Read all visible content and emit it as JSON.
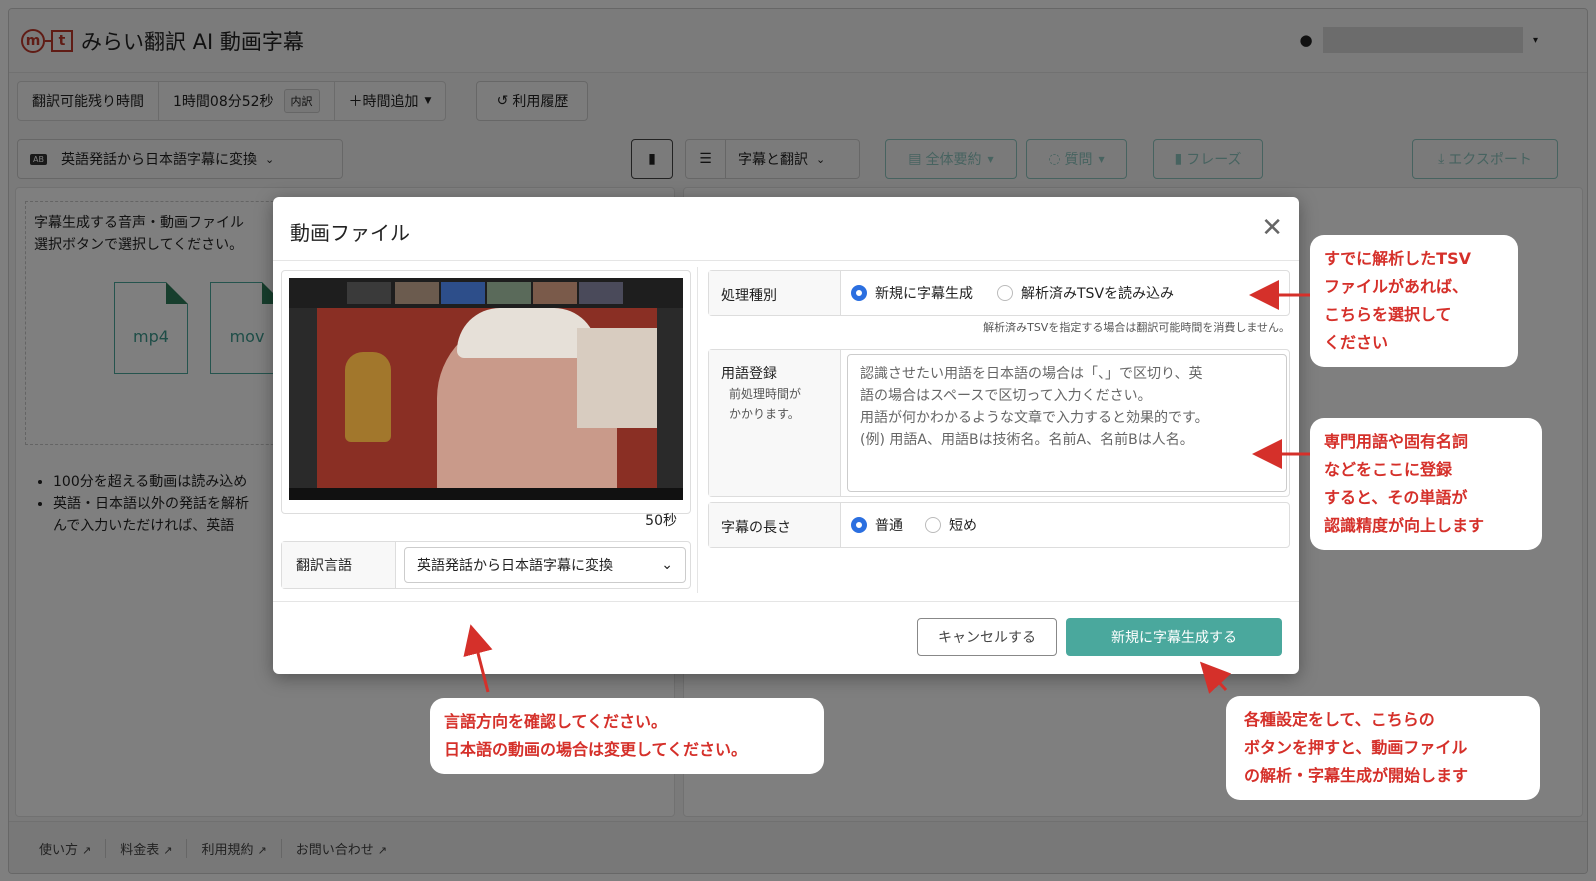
{
  "app": {
    "logo_m": "m",
    "logo_t": "t",
    "title": "みらい翻訳 AI 動画字幕",
    "user_caret": "▾"
  },
  "toolbar1": {
    "remaining_label": "翻訳可能残り時間",
    "remaining_value": "1時間08分52秒",
    "detail_badge": "内訳",
    "add_time": "＋時間追加",
    "history": "利用履歴"
  },
  "toolbar2": {
    "mode_icon": "AB",
    "mode": "英語発話から日本語字幕に変換",
    "view": "字幕と翻訳",
    "summary": "全体要約",
    "question": "質問",
    "phrase": "フレーズ",
    "export": "エクスポート"
  },
  "left_panel": {
    "instruction_l1": "字幕生成する音声・動画ファイル",
    "instruction_l2": "選択ボタンで選択してください。",
    "file_types": [
      "mp4",
      "mov"
    ],
    "bullet_1": "100分を超える動画は読み込め",
    "bullet_2": "英語・日本語以外の発話を解析",
    "bullet_2b": "んで入力いただければ、英語"
  },
  "footer": {
    "links": [
      "使い方",
      "料金表",
      "利用規約",
      "お問い合わせ"
    ]
  },
  "modal": {
    "title": "動画ファイル",
    "duration": "50秒",
    "lang_label": "翻訳言語",
    "lang_value": "英語発話から日本語字幕に変換",
    "proc_label": "処理種別",
    "proc_opt1": "新規に字幕生成",
    "proc_opt2": "解析済みTSVを読み込み",
    "proc_hint": "解析済みTSVを指定する場合は翻訳可能時間を消費しません。",
    "terms_label": "用語登録",
    "terms_sub1": "前処理時間が",
    "terms_sub2": "かかります。",
    "terms_ph_1": "認識させたい用語を日本語の場合は「、」で区切り、英",
    "terms_ph_2": "語の場合はスペースで区切って入力ください。",
    "terms_ph_3": "用語が何かわかるような文章で入力すると効果的です。",
    "terms_ph_4": "(例) 用語A、用語Bは技術名。名前A、名前Bは人名。",
    "len_label": "字幕の長さ",
    "len_opt1": "普通",
    "len_opt2": "短め",
    "cancel": "キャンセルする",
    "submit": "新規に字幕生成する"
  },
  "annotations": {
    "tsv_l1": "すでに解析したTSV",
    "tsv_l2": "ファイルがあれば、",
    "tsv_l3": "こちらを選択して",
    "tsv_l4": "ください",
    "terms_l1": "専門用語や固有名詞",
    "terms_l2": "などをここに登録",
    "terms_l3": "すると、その単語が",
    "terms_l4": "認識精度が向上します",
    "lang_l1": "言語方向を確認してください。",
    "lang_l2": "日本語の動画の場合は変更してください。",
    "btn_l1": "各種設定をして、こちらの",
    "btn_l2": "ボタンを押すと、動画ファイル",
    "btn_l3": "の解析・字幕生成が開始します"
  },
  "colors": {
    "accent": "#4aa89d",
    "annotation_red": "#d5302a",
    "radio_blue": "#2b6fe0",
    "brand_red": "#c0392b"
  }
}
